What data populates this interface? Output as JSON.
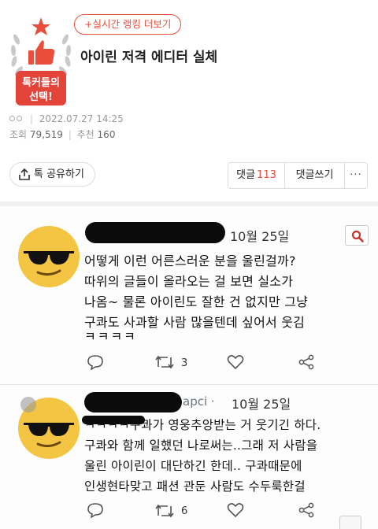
{
  "badge": {
    "line1": "톡커들의",
    "line2": "선택!"
  },
  "header": {
    "realtime_link": "+실시간 랭킹 더보기",
    "title": "아이린 저격 에디터 실체"
  },
  "meta": {
    "author": "ㅇㅇ",
    "date": "2022.07.27 14:25",
    "views_label": "조회",
    "views": "79,519",
    "recs_label": "추천",
    "recs": "160"
  },
  "actions": {
    "share": "톡 공유하기",
    "comment_label": "댓글",
    "comment_count": "113",
    "write": "댓글쓰기",
    "more": "···"
  },
  "tweets": [
    {
      "handle": "",
      "date": "10월 25일",
      "lines": [
        "어떻게 이런 어른스러운 분을 울린걸까?",
        "따위의 글들이 올라오는 걸 보면 실소가",
        "나옴~ 물론 아이린도 잘한 건 없지만 그냥",
        "구콰도 사과할 사람 많을텐데 싶어서 웃김",
        "ㅋㅋㅋㅋ"
      ],
      "retweets": "3"
    },
    {
      "handle": "apci ·",
      "date": "10월 25일",
      "lines": [
        "ㅋㅋㅋㅋ구콰가 영웅추앙받는 거 웃기긴 하다.",
        "구콰와 함께 일했던 나로써는..그래 저 사람을",
        "울린 아이린이 대단하긴 한데.. 구콰때문에",
        "인생현타맞고 패션 관둔 사람도 수두룩한걸"
      ],
      "retweets": "6"
    }
  ],
  "icons": {
    "badge": "thumbs-up-laurel-icon",
    "share": "share-icon",
    "search": "search-icon",
    "reply": "reply-icon",
    "retweet": "retweet-icon",
    "like": "heart-icon",
    "tweet_share": "share-nodes-icon"
  },
  "colors": {
    "accent": "#e94e3c",
    "badge_red": "#e2443a"
  }
}
